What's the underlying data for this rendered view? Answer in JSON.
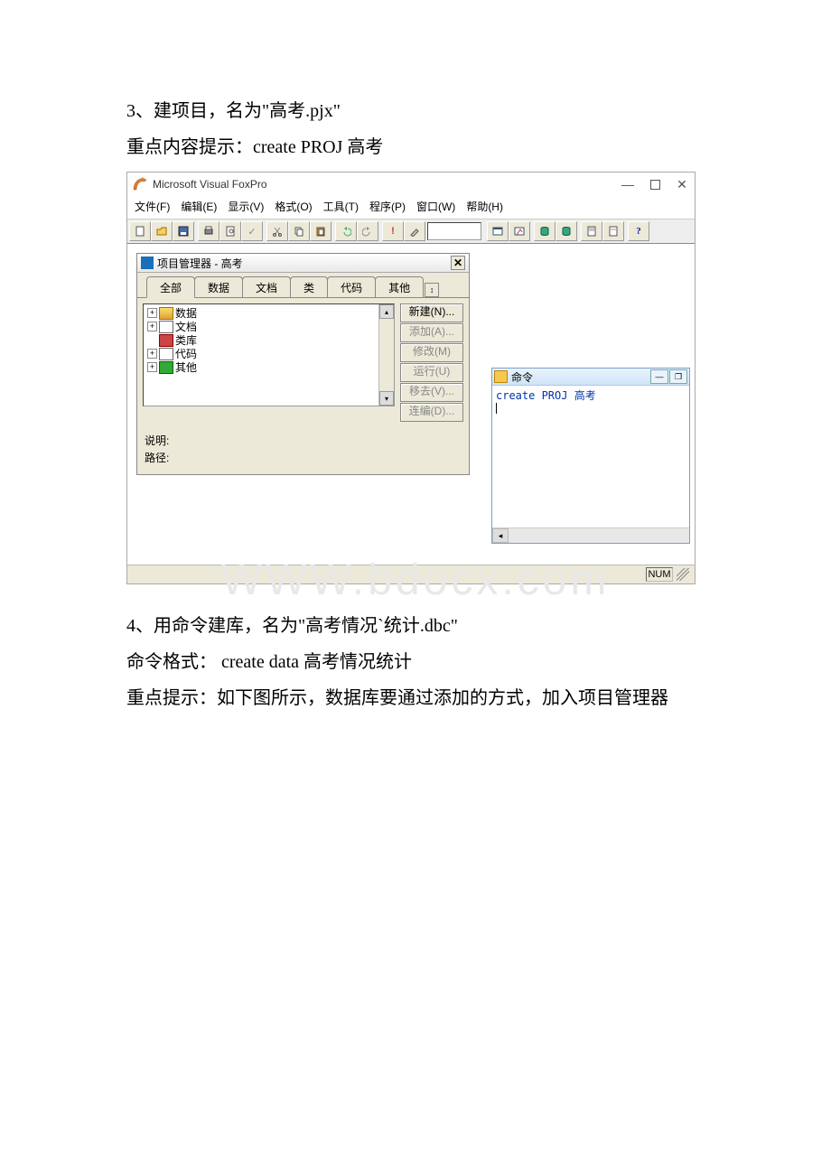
{
  "doc": {
    "line1": "3、建项目，名为\"高考.pjx\"",
    "line2": "重点内容提示：create PROJ 高考",
    "line3": "4、用命令建库，名为\"高考情况`统计.dbc\"",
    "line4": "命令格式： create data 高考情况统计",
    "line5": "重点提示：如下图所示，数据库要通过添加的方式，加入项目管理器"
  },
  "watermark": "WWW.bdocx.com",
  "vfp": {
    "app_title": "Microsoft Visual FoxPro",
    "menu": {
      "file": "文件(F)",
      "edit": "编辑(E)",
      "view": "显示(V)",
      "format": "格式(O)",
      "tools": "工具(T)",
      "program": "程序(P)",
      "window": "窗口(W)",
      "help": "帮助(H)"
    },
    "pm": {
      "title": "项目管理器 - 高考",
      "tabs": {
        "all": "全部",
        "data": "数据",
        "doc": "文档",
        "class": "类",
        "code": "代码",
        "other": "其他"
      },
      "tree": {
        "data": "数据",
        "doc": "文档",
        "class": "类库",
        "code": "代码",
        "other": "其他"
      },
      "buttons": {
        "new": "新建(N)...",
        "add": "添加(A)...",
        "modify": "修改(M)",
        "run": "运行(U)",
        "remove": "移去(V)...",
        "build": "连编(D)..."
      },
      "footer": {
        "desc_label": "说明:",
        "path_label": "路径:"
      }
    },
    "cmd": {
      "title": "命令",
      "line1": "create PROJ 高考"
    },
    "status": {
      "num": "NUM"
    }
  }
}
